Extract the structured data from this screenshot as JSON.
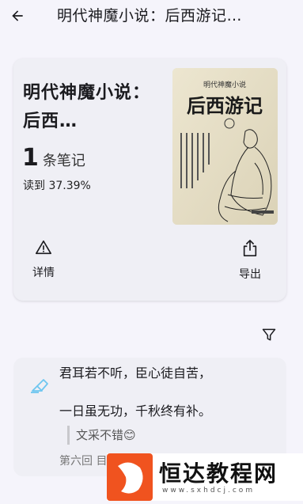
{
  "header": {
    "title": "明代神魔小说：后西游记…"
  },
  "book": {
    "title": "明代神魔小说：后西…",
    "notes_count": "1",
    "notes_label": "条笔记",
    "progress": "读到 37.39%",
    "cover_title": "后西游记"
  },
  "actions": {
    "details_label": "详情",
    "export_label": "导出"
  },
  "note": {
    "quote": "君耳若不听，臣心徒自苦，\n\n一日虽无功，千秋终有补。",
    "comment": "文采不错😊",
    "chapter": "第六回 目"
  },
  "watermark": {
    "text": "恒达教程网",
    "url": "www.sxhdcj.com"
  },
  "colors": {
    "background": "#f5f4fb",
    "card": "#efeff5",
    "highlight_icon": "#6ec6f0",
    "watermark_logo": "#f0531f"
  }
}
